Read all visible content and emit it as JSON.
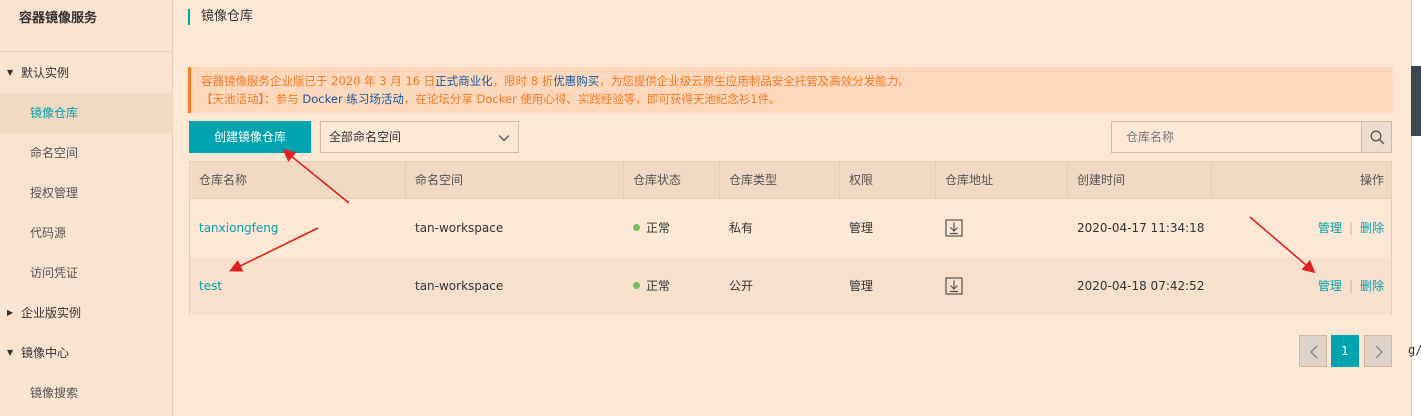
{
  "sidebar": {
    "title": "容器镜像服务",
    "groups": {
      "default": "默认实例",
      "enterprise": "企业版实例",
      "mirror": "镜像中心"
    },
    "items": {
      "repos": "镜像仓库",
      "namespaces": "命名空间",
      "auth": "授权管理",
      "code_source": "代码源",
      "credentials": "访问凭证",
      "mirror_search": "镜像搜索"
    },
    "active": "镜像仓库"
  },
  "header": {
    "title": "镜像仓库"
  },
  "notice": {
    "line1_prefix": "容器镜像服务企业版已于 2020 年 3 月 16 日",
    "line1_link1": "正式商业化",
    "line1_mid": "，限时 8 折",
    "line1_link2": "优惠购买",
    "line1_suffix": "，为您提供企业级云原生应用制品安全托管及高效分发能力。",
    "line2_prefix": "【天池活动】：参与 ",
    "line2_link": "Docker 练习场活动",
    "line2_suffix": "，在论坛分享 Docker 使用心得、实践经验等，即可获得天池纪念衫1件。"
  },
  "toolbar": {
    "create_label": "创建镜像仓库",
    "namespace_selected": "全部命名空间",
    "search_placeholder": "仓库名称"
  },
  "table": {
    "headers": {
      "name": "仓库名称",
      "namespace": "命名空间",
      "status": "仓库状态",
      "type": "仓库类型",
      "permission": "权限",
      "address": "仓库地址",
      "created": "创建时间",
      "ops": "操作"
    },
    "rows": [
      {
        "name": "tanxiongfeng",
        "namespace": "tan-workspace",
        "status": "正常",
        "type": "私有",
        "permission": "管理",
        "created": "2020-04-17 11:34:18",
        "manage": "管理",
        "delete": "删除",
        "sep": "|"
      },
      {
        "name": "test",
        "namespace": "tan-workspace",
        "status": "正常",
        "type": "公开",
        "permission": "管理",
        "created": "2020-04-18 07:42:52",
        "manage": "管理",
        "delete": "删除",
        "sep": "|"
      }
    ]
  },
  "pagination": {
    "current": "1"
  },
  "edge": {
    "text": "g/"
  },
  "colors": {
    "accent": "#00a4ae",
    "notice": "#f07b23",
    "status_ok": "#6fbf5c",
    "annotation": "#e02020"
  }
}
